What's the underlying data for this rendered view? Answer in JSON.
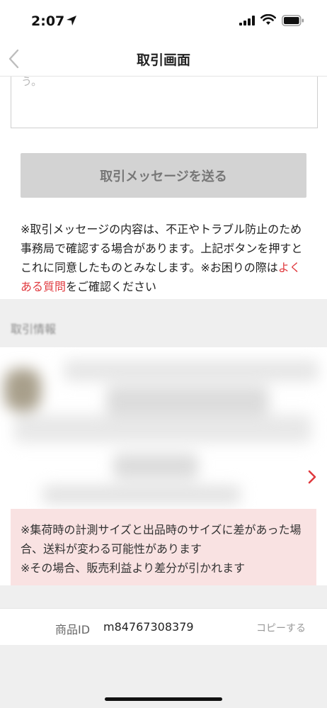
{
  "status_bar": {
    "time": "2:07"
  },
  "nav": {
    "title": "取引画面"
  },
  "message_box": {
    "placeholder_fragment": "う。"
  },
  "send_button": {
    "label": "取引メッセージを送る"
  },
  "notice": {
    "text_before_link": "※取引メッセージの内容は、不正やトラブル防止のため事務局で確認する場合があります。上記ボタンを押すとこれに同意したものとみなします。※お困りの際は",
    "link_text": "よくある質問",
    "text_after_link": "をご確認ください"
  },
  "section": {
    "title": "取引情報"
  },
  "warning": {
    "line1": "※集荷時の計測サイズと出品時のサイズに差があった場合、送料が変わる可能性があります",
    "line2": "※その場合、販売利益より差分が引かれます"
  },
  "product_id": {
    "label": "商品ID",
    "value": "m84767308379",
    "copy_label": "コピーする"
  },
  "colors": {
    "link": "#e0393e",
    "warning_bg": "#f9e2e2",
    "button_bg": "#d3d3d3",
    "chevron": "#e0393e"
  }
}
